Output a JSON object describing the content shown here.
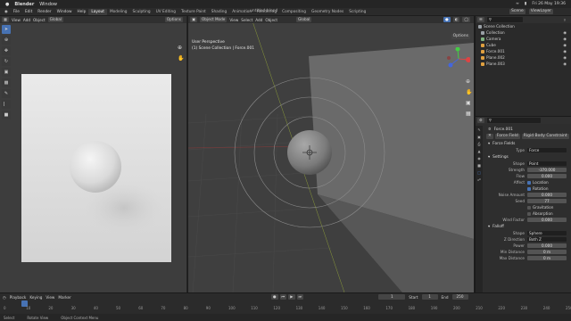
{
  "mac": {
    "apple": "",
    "app": "Blender",
    "window": "Window",
    "date": "Fri 26 May  19:36"
  },
  "window_title": "untitled.blend",
  "menus": [
    "File",
    "Edit",
    "Render",
    "Window",
    "Help"
  ],
  "workspaces": [
    "Layout",
    "Modeling",
    "Sculpting",
    "UV Editing",
    "Texture Paint",
    "Shading",
    "Animation",
    "Rendering",
    "Compositing",
    "Geometry Nodes",
    "Scripting"
  ],
  "scene": {
    "scene_label": "Scene",
    "view_layer": "ViewLayer"
  },
  "image_editor": {
    "header": [
      "View",
      "Add",
      "Object"
    ],
    "orientation": "Global",
    "options": "Options"
  },
  "viewport": {
    "mode": "Object Mode",
    "menus": [
      "View",
      "Select",
      "Add",
      "Object"
    ],
    "orientation": "Global",
    "title": "User Perspective",
    "subtitle": "(1) Scene Collection | Force.001",
    "options": "Options"
  },
  "outliner": {
    "root": "Scene Collection",
    "items": [
      {
        "name": "Collection",
        "color": "#9aa0a6"
      },
      {
        "name": "Camera",
        "color": "#7fb37f"
      },
      {
        "name": "Cube",
        "color": "#e0a040"
      },
      {
        "name": "Force.001",
        "color": "#e0a040"
      },
      {
        "name": "Plane.002",
        "color": "#e0a040"
      },
      {
        "name": "Plane.003",
        "color": "#e0a040"
      }
    ]
  },
  "properties": {
    "object": "Force.001",
    "tabs": [
      "Force Field",
      "Rigid Body Constraint"
    ],
    "panel_force": "Force Fields",
    "type_label": "Type",
    "type_value": "Force",
    "settings": "Settings",
    "rows": [
      {
        "label": "Shape",
        "value": "Point",
        "kind": "dark"
      },
      {
        "label": "Strength",
        "value": "-370.000",
        "kind": "field"
      },
      {
        "label": "Flow",
        "value": "0.000",
        "kind": "field"
      },
      {
        "label": "Affect",
        "value": "Location",
        "kind": "check"
      },
      {
        "label": "",
        "value": "Rotation",
        "kind": "check"
      },
      {
        "label": "Noise Amount",
        "value": "0.000",
        "kind": "field"
      },
      {
        "label": "Seed",
        "value": "77",
        "kind": "field"
      },
      {
        "label": "",
        "value": "Gravitation",
        "kind": "checkoff"
      },
      {
        "label": "",
        "value": "Absorption",
        "kind": "checkoff"
      },
      {
        "label": "Wind Factor",
        "value": "0.000",
        "kind": "field"
      }
    ],
    "falloff": "Falloff",
    "falloff_rows": [
      {
        "label": "Shape",
        "value": "Sphere",
        "kind": "dark"
      },
      {
        "label": "Z Direction",
        "value": "Both Z",
        "kind": "dark"
      },
      {
        "label": "Power",
        "value": "0.000",
        "kind": "field"
      },
      {
        "label": "Min Distance",
        "value": "0 m",
        "kind": "field"
      },
      {
        "label": "Max Distance",
        "value": "0 m",
        "kind": "field"
      }
    ]
  },
  "timeline": {
    "menus": [
      "Playback",
      "Keying",
      "View",
      "Marker"
    ],
    "current": "1",
    "start_label": "Start",
    "start": "1",
    "end_label": "End",
    "end": "250",
    "ticks": [
      "0",
      "10",
      "20",
      "30",
      "40",
      "50",
      "60",
      "70",
      "80",
      "90",
      "100",
      "110",
      "120",
      "130",
      "140",
      "150",
      "160",
      "170",
      "180",
      "190",
      "200",
      "210",
      "220",
      "230",
      "240",
      "250"
    ]
  },
  "status": [
    "Select",
    "Rotate View",
    "Object Context Menu"
  ]
}
